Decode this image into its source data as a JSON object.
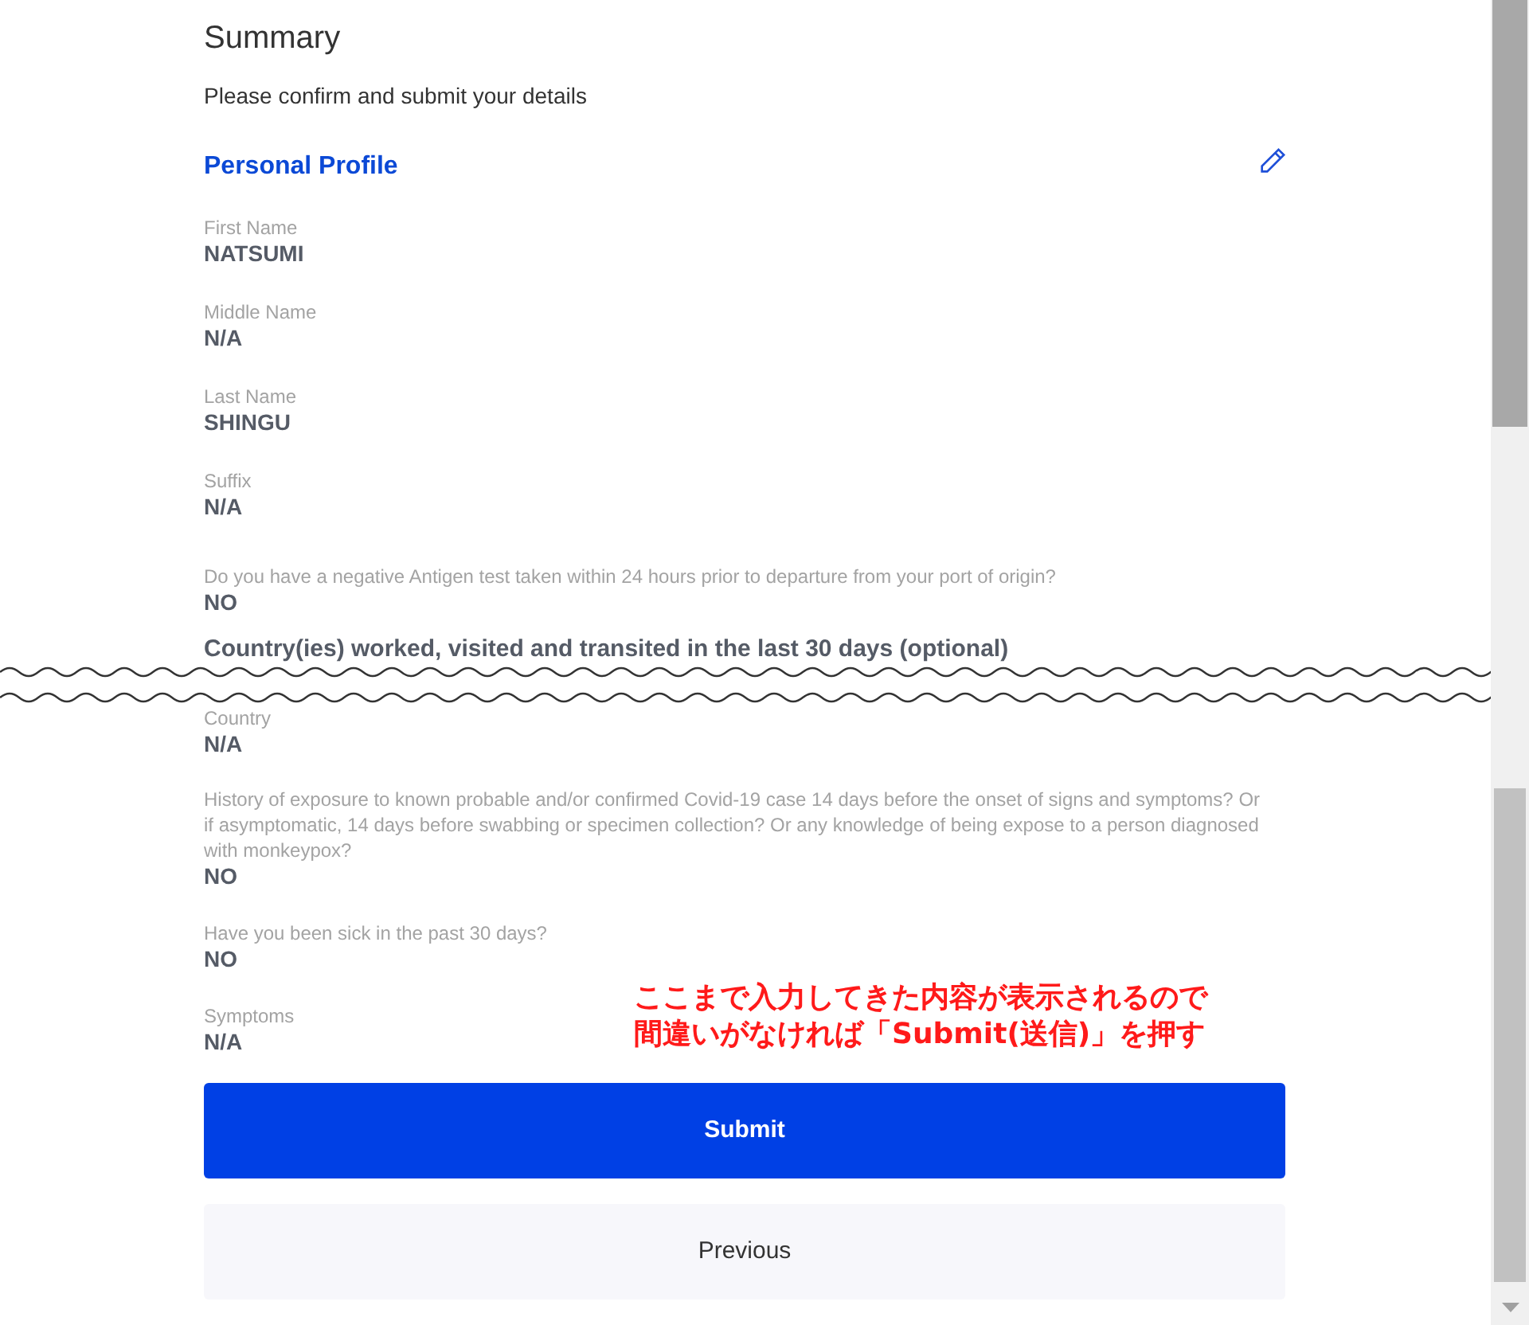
{
  "title": "Summary",
  "subtitle": "Please confirm and submit your details",
  "section": {
    "title": "Personal Profile"
  },
  "fields_top": [
    {
      "label": "First Name",
      "value": "NATSUMI"
    },
    {
      "label": "Middle Name",
      "value": "N/A"
    },
    {
      "label": "Last Name",
      "value": "SHINGU"
    },
    {
      "label": "Suffix",
      "value": "N/A"
    },
    {
      "label": "Do you have a negative Antigen test taken within 24 hours prior to departure from your port of origin?",
      "value": "NO"
    }
  ],
  "subheading": "Country(ies) worked, visited and transited in the last 30 days (optional)",
  "fields_bottom": [
    {
      "label": "Country",
      "value": "N/A"
    },
    {
      "label": "History of exposure to known probable and/or confirmed Covid-19 case 14 days before the onset of signs and symptoms? Or if asymptomatic, 14 days before swabbing or specimen collection? Or any knowledge of being expose to a person diagnosed with monkeypox?",
      "value": "NO"
    },
    {
      "label": "Have you been sick in the past 30 days?",
      "value": "NO"
    },
    {
      "label": "Symptoms",
      "value": "N/A"
    }
  ],
  "annotation": [
    "ここまで入力してきた内容が表示されるので",
    "間違いがなければ「Submit(送信)」を押す"
  ],
  "buttons": [
    {
      "label": "Submit",
      "kind": "primary"
    },
    {
      "label": "Previous",
      "kind": "secondary"
    }
  ]
}
